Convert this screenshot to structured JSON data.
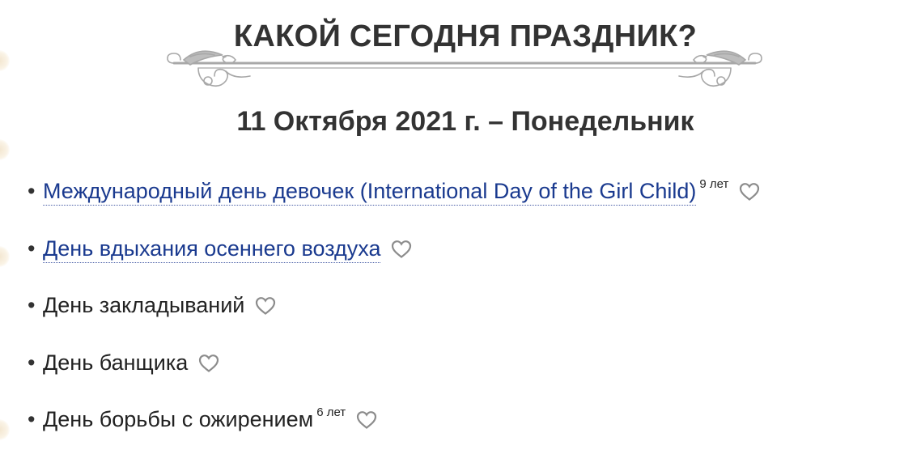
{
  "page": {
    "title": "КАКОЙ СЕГОДНЯ ПРАЗДНИК?",
    "date_heading": "11 Октября 2021 г. – Понедельник"
  },
  "holidays": [
    {
      "bullet": "•",
      "name": "Международный день девочек (International Day of the Girl Child)",
      "years": "9 лет",
      "linked": true,
      "icon": "heart-outline-icon"
    },
    {
      "bullet": "•",
      "name": "День вдыхания осеннего воздуха",
      "years": "",
      "linked": true,
      "icon": "heart-outline-icon"
    },
    {
      "bullet": "•",
      "name": "День закладываний",
      "years": "",
      "linked": false,
      "icon": "heart-outline-icon"
    },
    {
      "bullet": "•",
      "name": "День банщика",
      "years": "",
      "linked": false,
      "icon": "heart-outline-icon"
    },
    {
      "bullet": "•",
      "name": "День борьбы с ожирением",
      "years": "6 лет",
      "linked": false,
      "icon": "heart-outline-icon"
    }
  ],
  "colors": {
    "link": "#1a3a8f",
    "text": "#222222",
    "heading": "#333333",
    "ornament": "#a8a8a8",
    "heart": "#8c8c8c"
  }
}
